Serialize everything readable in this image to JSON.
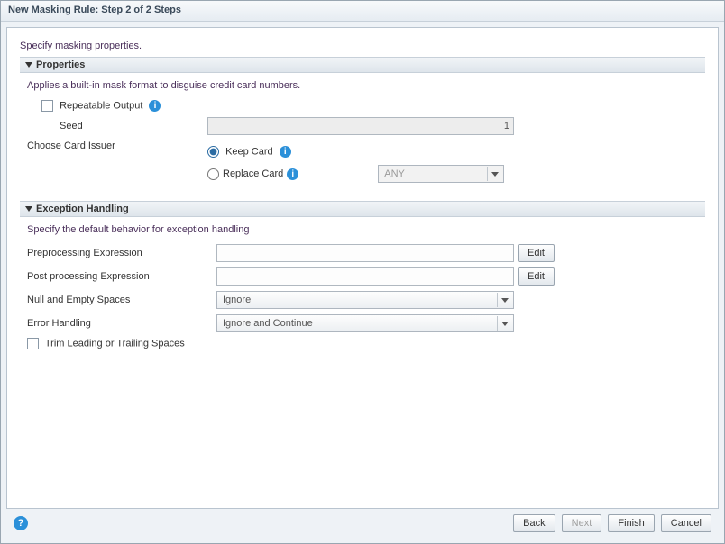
{
  "window": {
    "title": "New Masking Rule: Step 2 of 2 Steps"
  },
  "intro": "Specify masking properties.",
  "properties": {
    "heading": "Properties",
    "desc": "Applies a built-in mask format to disguise credit card numbers.",
    "repeatable_label": "Repeatable Output",
    "seed_label": "Seed",
    "seed_value": "1",
    "issuer_label": "Choose Card Issuer",
    "keep_card_label": "Keep Card",
    "replace_card_label": "Replace Card",
    "replace_card_value": "ANY",
    "issuer_selected": "keep"
  },
  "exception": {
    "heading": "Exception Handling",
    "desc": "Specify the default behavior for exception handling",
    "preprocessing_label": "Preprocessing Expression",
    "postprocessing_label": "Post processing Expression",
    "null_empty_label": "Null and Empty Spaces",
    "null_empty_value": "Ignore",
    "error_label": "Error Handling",
    "error_value": "Ignore and Continue",
    "trim_label": "Trim Leading or Trailing Spaces",
    "edit_btn": "Edit"
  },
  "footer": {
    "back": "Back",
    "next": "Next",
    "finish": "Finish",
    "cancel": "Cancel"
  }
}
